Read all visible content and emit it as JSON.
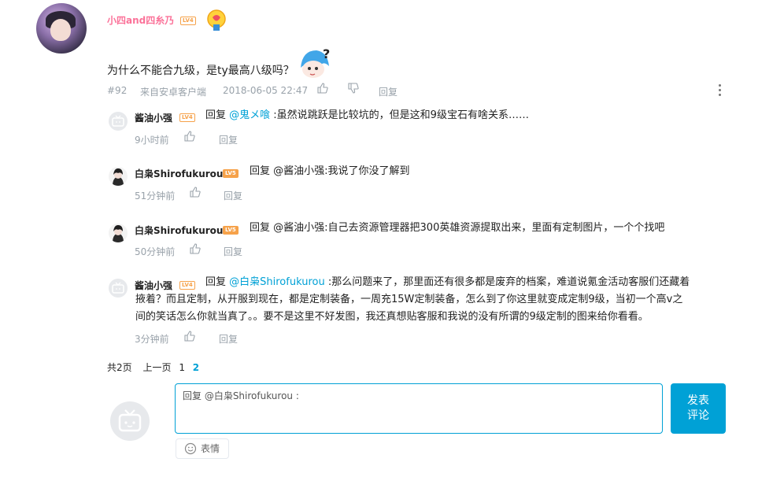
{
  "main_comment": {
    "username": "小四and四糸乃",
    "level": "LV4",
    "text": "为什么不能合九级，是ty最高八级吗？",
    "floor": "#92",
    "source": "来自安卓客户端",
    "time": "2018-06-05 22:47",
    "reply_label": "回复"
  },
  "replies": [
    {
      "username": "酱油小强",
      "level": "LV4",
      "prefix": "回复 ",
      "at": "@鬼メ喰",
      "text": " :虽然说跳跃是比较坑的，但是这和9级宝石有啥关系……",
      "time": "9小时前",
      "reply_label": "回复"
    },
    {
      "username": "白枭Shirofukurou",
      "level": "LV5",
      "prefix": "回复 ",
      "at": "",
      "text": "@酱油小强:我说了你没了解到",
      "time": "51分钟前",
      "reply_label": "回复"
    },
    {
      "username": "白枭Shirofukurou",
      "level": "LV5",
      "prefix": "回复 ",
      "at": "",
      "text": "@酱油小强:自己去资源管理器把300英雄资源提取出来，里面有定制图片，一个个找吧",
      "time": "50分钟前",
      "reply_label": "回复"
    },
    {
      "username": "酱油小强",
      "level": "LV4",
      "prefix": "回复 ",
      "at": "@白枭Shirofukurou",
      "text_line1": " :那么问题来了，那里面还有很多都是废弃的档案，难道说氪金活动客服们还藏着",
      "text_line2": "掖着？而且定制，从开服到现在，都是定制装备，一周充15W定制装备，怎么到了你这里就变成定制9级，当初一个高v之",
      "text_line3": "间的笑话怎么你就当真了。。要不是这里不好发图，我还真想贴客服和我说的没有所谓的9级定制的图来给你看看。",
      "time": "3分钟前",
      "reply_label": "回复"
    }
  ],
  "pager": {
    "total": "共2页",
    "prev": "上一页",
    "page1": "1",
    "page2": "2"
  },
  "composer": {
    "placeholder": "回复 @白枭Shirofukurou :",
    "send_line1": "发表",
    "send_line2": "评论",
    "emoji_label": "表情"
  },
  "colors": {
    "accent": "#00a1d6",
    "username_pink": "#fb7299",
    "meta_gray": "#99a2aa",
    "level_orange": "#f6a24a"
  },
  "icons": {
    "like": "thumbs-up-icon",
    "dislike": "thumbs-down-icon",
    "more": "more-vertical-icon",
    "emoji": "smile-icon"
  }
}
